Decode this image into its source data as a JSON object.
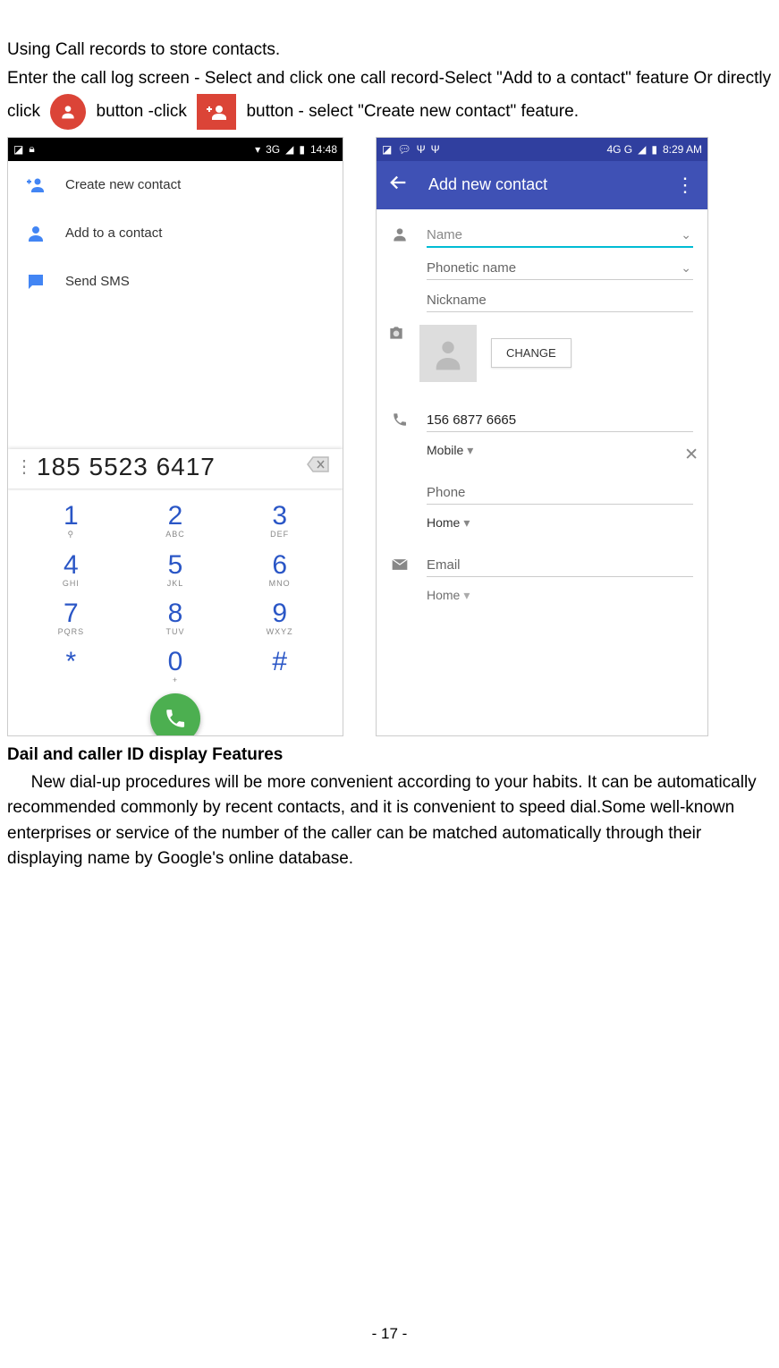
{
  "instructions": {
    "line1": "Using Call records to store contacts.",
    "line2a": "Enter the call log screen - Select and click one call record-Select \"Add to a contact\" feature Or directly click",
    "line2b": "button -click",
    "line2c": "button - select \"Create new contact\" feature."
  },
  "left": {
    "status": {
      "net": "3G",
      "time": "14:48"
    },
    "menu": {
      "create": "Create new contact",
      "add": "Add to a contact",
      "sms": "Send SMS"
    },
    "number": "185 5523 6417",
    "keys": [
      {
        "d": "1",
        "l": "⚲"
      },
      {
        "d": "2",
        "l": "ABC"
      },
      {
        "d": "3",
        "l": "DEF"
      },
      {
        "d": "4",
        "l": "GHI"
      },
      {
        "d": "5",
        "l": "JKL"
      },
      {
        "d": "6",
        "l": "MNO"
      },
      {
        "d": "7",
        "l": "PQRS"
      },
      {
        "d": "8",
        "l": "TUV"
      },
      {
        "d": "9",
        "l": "WXYZ"
      },
      {
        "d": "*",
        "l": ""
      },
      {
        "d": "0",
        "l": "+"
      },
      {
        "d": "#",
        "l": ""
      }
    ]
  },
  "right": {
    "status": {
      "net": "4G     G",
      "time": "8:29 AM"
    },
    "title": "Add new contact",
    "fields": {
      "name": "Name",
      "phonetic": "Phonetic name",
      "nickname": "Nickname",
      "change": "CHANGE",
      "phone_value": "156 6877 6665",
      "mobile": "Mobile",
      "phone": "Phone",
      "home": "Home",
      "email": "Email",
      "home2": "Home"
    }
  },
  "heading": "Dail and caller ID display Features",
  "para": "New dial-up procedures will be more convenient according to your habits. It can be automatically recommended commonly by recent contacts, and it is convenient to speed dial.Some well-known enterprises or service of the number of the caller can be matched automatically through their displaying name by Google's online database.",
  "page": "- 17 -"
}
